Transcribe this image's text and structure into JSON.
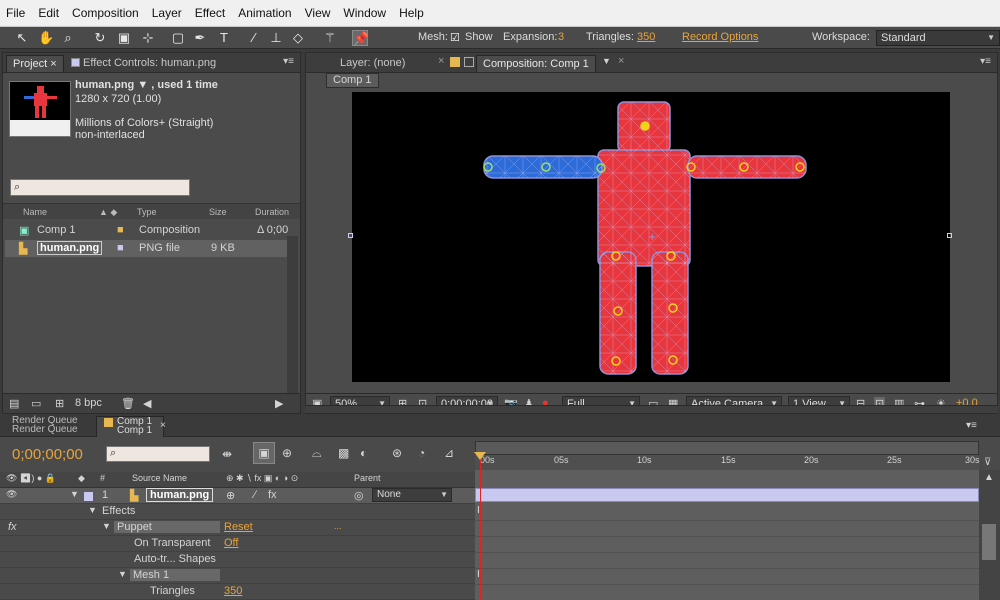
{
  "menu": [
    "File",
    "Edit",
    "Composition",
    "Layer",
    "Effect",
    "Animation",
    "View",
    "Window",
    "Help"
  ],
  "toolbar": {
    "mesh_label": "Mesh:",
    "show_label": "Show",
    "expansion_label": "Expansion:",
    "expansion_value": "3",
    "triangles_label": "Triangles:",
    "triangles_value": "350",
    "record_options": "Record Options",
    "workspace_label": "Workspace:",
    "workspace_value": "Standard"
  },
  "project_panel": {
    "tab_project": "Project ×",
    "tab_effect_controls": "Effect Controls: human.png",
    "info_name": "human.png ▼ , used 1 time",
    "info_size": "1280 x 720 (1.00)",
    "info_colors": "Millions of Colors+ (Straight)",
    "info_interlace": "non-interlaced",
    "search_icon": "search-icon",
    "columns": {
      "name": "Name",
      "type": "Type",
      "size": "Size",
      "duration": "Duration"
    },
    "items": [
      {
        "name": "Comp 1",
        "type": "Composition",
        "size": "",
        "duration": "Δ 0;00"
      },
      {
        "name": "human.png",
        "type": "PNG file",
        "size": "9 KB",
        "duration": ""
      }
    ],
    "bpc": "8 bpc"
  },
  "comp_panel": {
    "tab_layer": "Layer: (none)",
    "tab_composition": "Composition: Comp 1",
    "breadcrumb": "Comp 1",
    "zoom": "50%",
    "timecode": "0;00;00;00",
    "resolution": "Full",
    "camera": "Active Camera",
    "view": "1 View",
    "exposure": "+0.0"
  },
  "timeline": {
    "tab_render_queue": "Render Queue",
    "tab_comp": "Comp 1",
    "timecode": "0;00;00;00",
    "col_source_name": "Source Name",
    "col_parent": "Parent",
    "col_num": "#",
    "layer_num": "1",
    "layer_name": "human.png",
    "parent_value": "None",
    "effects_label": "Effects",
    "fx_label": "fx",
    "puppet_label": "Puppet",
    "reset_label": "Reset",
    "on_transparent_label": "On Transparent",
    "on_transparent_value": "Off",
    "auto_shapes_label": "Auto-tr... Shapes",
    "mesh_label": "Mesh 1",
    "triangles_label": "Triangles",
    "triangles_value": "350",
    "ruler": [
      "00s",
      "05s",
      "10s",
      "15s",
      "20s",
      "25s",
      "30s"
    ]
  },
  "colors": {
    "accent": "#e8a43a",
    "figure_red": "#e8363e",
    "arm_blue": "#2d6bd8",
    "pin_yellow": "#f2d21b",
    "selection_blue": "#c8c8f0",
    "playhead_red": "#e22222"
  }
}
